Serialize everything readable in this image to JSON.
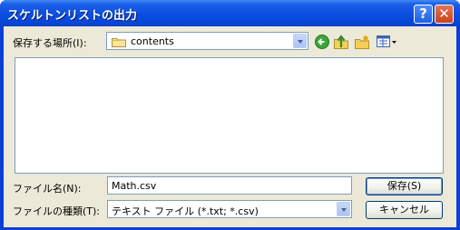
{
  "window": {
    "title": "スケルトンリストの出力"
  },
  "titlebar_buttons": {
    "help": "?",
    "close": "✕"
  },
  "save_in": {
    "label": "保存する場所(I):",
    "value": "contents"
  },
  "toolbar": {
    "icons": [
      "back-icon",
      "up-folder-icon",
      "new-folder-icon",
      "view-menu-icon"
    ]
  },
  "file_name": {
    "label": "ファイル名(N):",
    "value": "Math.csv"
  },
  "file_type": {
    "label": "ファイルの種類(T):",
    "value": "テキスト ファイル (*.txt; *.csv)"
  },
  "buttons": {
    "save": "保存(S)",
    "cancel": "キャンセル"
  },
  "colors": {
    "titlebar": "#0a4ee0",
    "client": "#ece9d8",
    "border": "#7f9db9"
  }
}
